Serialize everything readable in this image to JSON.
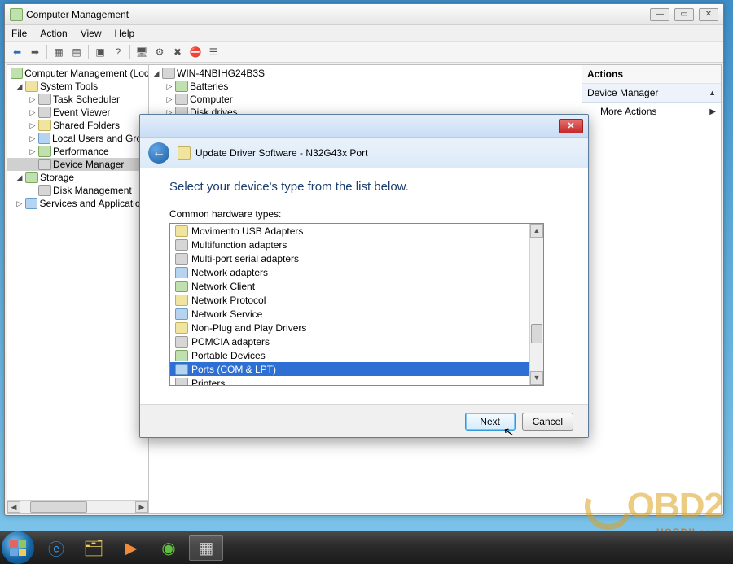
{
  "window": {
    "title": "Computer Management",
    "menu": {
      "file": "File",
      "action": "Action",
      "view": "View",
      "help": "Help"
    },
    "controls": {
      "min": "—",
      "max": "▭",
      "close": "✕"
    }
  },
  "tree": {
    "root": "Computer Management (Local",
    "system_tools": "System Tools",
    "task_scheduler": "Task Scheduler",
    "event_viewer": "Event Viewer",
    "shared_folders": "Shared Folders",
    "local_users": "Local Users and Group",
    "performance": "Performance",
    "device_manager": "Device Manager",
    "storage": "Storage",
    "disk_management": "Disk Management",
    "services_apps": "Services and Applications"
  },
  "center": {
    "host": "WIN-4NBIHG24B3S",
    "batteries": "Batteries",
    "computer": "Computer",
    "disk_drives": "Disk drives"
  },
  "actions": {
    "heading": "Actions",
    "section": "Device Manager",
    "more": "More Actions"
  },
  "dialog": {
    "title": "Update Driver Software - N32G43x Port",
    "instruction": "Select your device's type from the list below.",
    "label": "Common hardware types:",
    "items": [
      "Movimento USB Adapters",
      "Multifunction adapters",
      "Multi-port serial adapters",
      "Network adapters",
      "Network Client",
      "Network Protocol",
      "Network Service",
      "Non-Plug and Play Drivers",
      "PCMCIA adapters",
      "Portable Devices",
      "Ports (COM & LPT)",
      "Printers"
    ],
    "selected_index": 10,
    "next": "Next",
    "cancel": "Cancel",
    "close_x": "✕"
  },
  "watermark": {
    "main": "OBD2",
    "sub": "UOBDII.com"
  }
}
